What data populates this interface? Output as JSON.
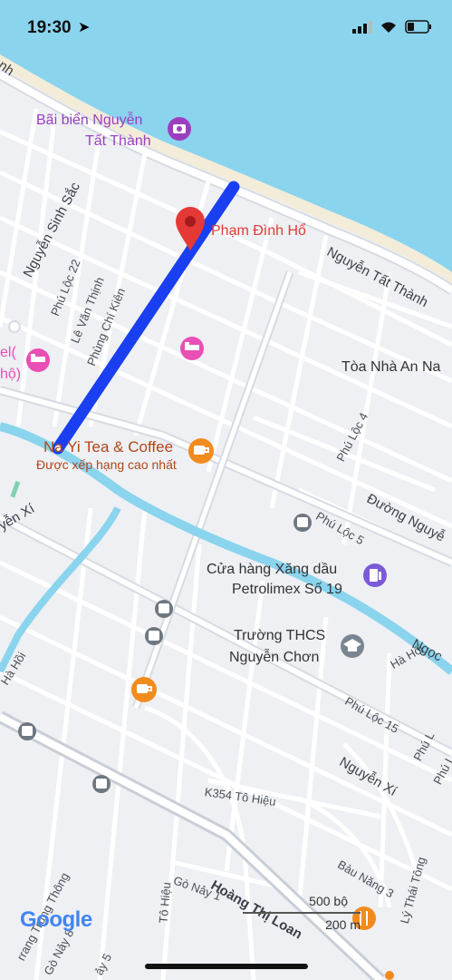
{
  "status_bar": {
    "time": "19:30"
  },
  "pin": {
    "label": "Phạm Đình Hổ",
    "color": "#e53935"
  },
  "route": {
    "color": "#1a3ff0"
  },
  "pois": {
    "beach": {
      "title_line1": "Bãi biển Nguyễn",
      "title_line2": "Tất Thành",
      "color": "#9c3fbf"
    },
    "cafe_top": {
      "title": "Na Yi Tea & Coffee",
      "subtitle": "Được xếp hạng cao nhất"
    },
    "gas_station": {
      "title_line1": "Cửa hàng Xăng dầu",
      "title_line2": "Petrolimex Số 19"
    },
    "school": {
      "title_line1": "Trường THCS",
      "title_line2": "Nguyễn Chơn"
    },
    "building": {
      "title": "Tòa Nhà An Na"
    },
    "hotel_left": {
      "label_line1": "el(",
      "label_line2": "hộ)"
    }
  },
  "streets": {
    "nguyen_tat_thanh": "Nguyễn Tất Thành",
    "nguyen_sinh_sac": "Nguyễn Sinh Sắc",
    "phu_loc_22": "Phú Lộc 22",
    "le_van_thinh": "Lê Văn Thịnh",
    "phung_chi_kien": "Phùng Chí Kiên",
    "phu_loc_4": "Phú Lộc 4",
    "phu_loc_5": "Phú Lộc 5",
    "duong_nguyen": "Đường Nguyễ",
    "nguyen_xi_left": "yễn Xí",
    "nguyen_xi": "Nguyễn Xí",
    "ha_hoi_left": "Hà Hồi",
    "ha_hoi_right": "Hà Hồi",
    "ngoc": "Ngọc",
    "phu_loc_15": "Phú Lộc 15",
    "phu_loc_right": "Phú L",
    "k354": "K354 Tô Hiệu",
    "bau_nang_3": "Bàu Năng 3",
    "hoang_thi_loan": "Hoàng Thị Loan",
    "go_nay_1": "Gò Nảy 1",
    "to_hieu": "Tô Hiệu",
    "ly_thai_tong": "Lý Thái Tông",
    "trung_thong": "rrang Trung Thông",
    "top_left": "nh",
    "go_nay_8": "Gò Nảy 8",
    "nay_5": "ảy 5",
    "phu_loc_far": "Phú L"
  },
  "scale": {
    "top": "500 bộ",
    "bottom": "200 m"
  },
  "logo": {
    "text": "Google"
  },
  "colors": {
    "water": "#8ad4ee",
    "canal": "#8ad4ee",
    "land": "#eef0f3",
    "road": "#ffffff",
    "major_road": "#d7dbe2",
    "beach": "#f3ecd9",
    "pin": "#e53935",
    "hotel_icon": "#e94fb4",
    "cafe_icon": "#f28b1e",
    "gas_icon": "#7a5ad9",
    "transit_icon": "#6f7780",
    "school_icon": "#7a8590"
  }
}
